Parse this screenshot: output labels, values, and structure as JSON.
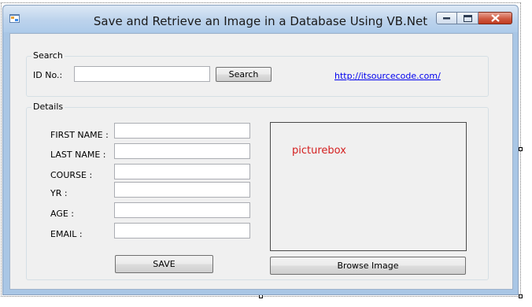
{
  "window": {
    "title": "Save and Retrieve an Image in a Database Using VB.Net"
  },
  "search_group": {
    "title": "Search",
    "id_label": "ID No.:",
    "id_value": "",
    "search_button": "Search",
    "link_text": "http://itsourcecode.com/"
  },
  "details_group": {
    "title": "Details",
    "fields": [
      {
        "label": "FIRST NAME :",
        "value": ""
      },
      {
        "label": "LAST NAME :",
        "value": ""
      },
      {
        "label": "COURSE :",
        "value": ""
      },
      {
        "label": "YR :",
        "value": ""
      },
      {
        "label": "AGE :",
        "value": ""
      },
      {
        "label": "EMAIL :",
        "value": ""
      }
    ],
    "save_button": "SAVE",
    "picturebox_text": "picturebox",
    "browse_button": "Browse Image"
  },
  "colors": {
    "title_bar": "#bdd3ec",
    "close_button": "#c13b1f",
    "form_background": "#f0f0f0",
    "link": "#0000ee",
    "picturebox_text": "#d42020"
  },
  "icons": [
    "app-icon",
    "minimize-icon",
    "maximize-icon",
    "close-icon"
  ]
}
